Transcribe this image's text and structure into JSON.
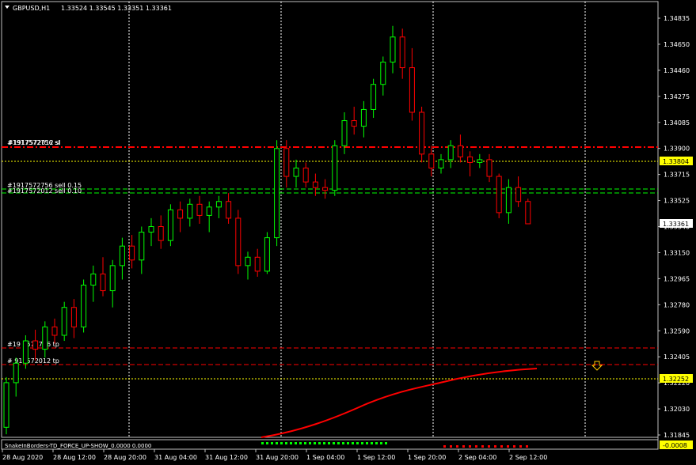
{
  "header": {
    "symbol": "GBPUSD,H1",
    "ohlc": "1.33524 1.33545 1.33351 1.33361"
  },
  "price_axis": [
    "1.34835",
    "1.34650",
    "1.34460",
    "1.34275",
    "1.34085",
    "1.33900",
    "1.33715",
    "1.33525",
    "1.33340",
    "1.33150",
    "1.32965",
    "1.32780",
    "1.32590",
    "1.32405",
    "1.32220",
    "1.32030",
    "1.31845"
  ],
  "time_axis": [
    "28 Aug 2020",
    "28 Aug 12:00",
    "28 Aug 20:00",
    "31 Aug 04:00",
    "31 Aug 12:00",
    "31 Aug 20:00",
    "1 Sep 04:00",
    "1 Sep 12:00",
    "1 Sep 20:00",
    "2 Sep 04:00",
    "2 Sep 12:00"
  ],
  "price_tags": {
    "stop_level": "1.33804",
    "current": "1.33361",
    "target_level": "1.32252",
    "indicator_value": "-0.0008"
  },
  "orders": {
    "sl_label": "#1917572756 sl",
    "sl_label_overlap": "#1917572012 sl",
    "sell1_label": "#1917572756 sell 0.15",
    "sell2_label": "#1917572012 sell 0.10",
    "tp1_label": "#19 7572756 tp",
    "tp2_label": "# 917572012 tp"
  },
  "indicator": {
    "label": "SnakeInBorders-TD_FORCE_UP-SHOW_0.0000 0.0000"
  },
  "colors": {
    "background": "#000000",
    "bull": "#00ff00",
    "bear": "#ff0000",
    "grid": "#c0c0c0",
    "order_line": "#ff0000",
    "sell_line": "#00ff00",
    "level_line": "#ffff00",
    "ma_line": "#ff0000"
  },
  "chart_data": {
    "type": "candlestick",
    "symbol": "GBPUSD",
    "timeframe": "H1",
    "ylim": [
      1.318,
      1.3493
    ],
    "x": [
      "28 Aug 2020",
      "28 Aug 12:00",
      "28 Aug 20:00",
      "31 Aug 04:00",
      "31 Aug 12:00",
      "31 Aug 20:00",
      "1 Sep 04:00",
      "1 Sep 12:00",
      "1 Sep 20:00",
      "2 Sep 04:00",
      "2 Sep 12:00"
    ],
    "candles": [
      [
        1.319,
        1.3226,
        1.3185,
        1.3222
      ],
      [
        1.3222,
        1.324,
        1.3212,
        1.3236
      ],
      [
        1.3236,
        1.3256,
        1.3232,
        1.3252
      ],
      [
        1.3252,
        1.326,
        1.3238,
        1.3246
      ],
      [
        1.3246,
        1.3266,
        1.324,
        1.3262
      ],
      [
        1.3262,
        1.3268,
        1.325,
        1.3256
      ],
      [
        1.3256,
        1.328,
        1.3252,
        1.3276
      ],
      [
        1.3276,
        1.3282,
        1.3254,
        1.3262
      ],
      [
        1.3262,
        1.3296,
        1.3258,
        1.3292
      ],
      [
        1.3292,
        1.3306,
        1.328,
        1.33
      ],
      [
        1.33,
        1.3312,
        1.3284,
        1.3288
      ],
      [
        1.3288,
        1.331,
        1.3276,
        1.3306
      ],
      [
        1.3306,
        1.3326,
        1.3296,
        1.332
      ],
      [
        1.332,
        1.3328,
        1.3304,
        1.331
      ],
      [
        1.331,
        1.3334,
        1.33,
        1.333
      ],
      [
        1.333,
        1.334,
        1.332,
        1.3334
      ],
      [
        1.3334,
        1.3342,
        1.3318,
        1.3324
      ],
      [
        1.3324,
        1.335,
        1.332,
        1.3346
      ],
      [
        1.3346,
        1.3352,
        1.333,
        1.334
      ],
      [
        1.334,
        1.3354,
        1.3334,
        1.335
      ],
      [
        1.335,
        1.3356,
        1.3336,
        1.3342
      ],
      [
        1.3342,
        1.3352,
        1.333,
        1.3348
      ],
      [
        1.3348,
        1.3356,
        1.334,
        1.3352
      ],
      [
        1.3352,
        1.3358,
        1.3336,
        1.334
      ],
      [
        1.334,
        1.3346,
        1.33,
        1.3306
      ],
      [
        1.3306,
        1.3316,
        1.3296,
        1.3312
      ],
      [
        1.3312,
        1.3318,
        1.3298,
        1.3302
      ],
      [
        1.3302,
        1.333,
        1.33,
        1.3326
      ],
      [
        1.3326,
        1.3396,
        1.332,
        1.339
      ],
      [
        1.339,
        1.3396,
        1.3362,
        1.337
      ],
      [
        1.337,
        1.3382,
        1.3362,
        1.3376
      ],
      [
        1.3376,
        1.338,
        1.3362,
        1.3366
      ],
      [
        1.3366,
        1.3372,
        1.3356,
        1.3362
      ],
      [
        1.3362,
        1.3368,
        1.3354,
        1.336
      ],
      [
        1.336,
        1.3396,
        1.3356,
        1.3392
      ],
      [
        1.3392,
        1.3416,
        1.3386,
        1.341
      ],
      [
        1.341,
        1.342,
        1.34,
        1.3406
      ],
      [
        1.3406,
        1.3424,
        1.3398,
        1.3418
      ],
      [
        1.3418,
        1.344,
        1.3412,
        1.3436
      ],
      [
        1.3436,
        1.3456,
        1.3428,
        1.3452
      ],
      [
        1.3452,
        1.3478,
        1.3444,
        1.347
      ],
      [
        1.347,
        1.3476,
        1.344,
        1.3448
      ],
      [
        1.3448,
        1.3462,
        1.341,
        1.3416
      ],
      [
        1.3416,
        1.342,
        1.338,
        1.3386
      ],
      [
        1.3386,
        1.3392,
        1.337,
        1.3376
      ],
      [
        1.3376,
        1.3386,
        1.3372,
        1.3382
      ],
      [
        1.3382,
        1.3396,
        1.3376,
        1.3392
      ],
      [
        1.3392,
        1.34,
        1.338,
        1.3384
      ],
      [
        1.3384,
        1.3388,
        1.337,
        1.338
      ],
      [
        1.338,
        1.3386,
        1.3376,
        1.3382
      ],
      [
        1.3382,
        1.3386,
        1.3366,
        1.337
      ],
      [
        1.337,
        1.3372,
        1.334,
        1.3344
      ],
      [
        1.3344,
        1.3368,
        1.3336,
        1.3362
      ],
      [
        1.3362,
        1.337,
        1.3348,
        1.3352
      ],
      [
        1.3352,
        1.3354,
        1.3336,
        1.3336
      ]
    ]
  }
}
